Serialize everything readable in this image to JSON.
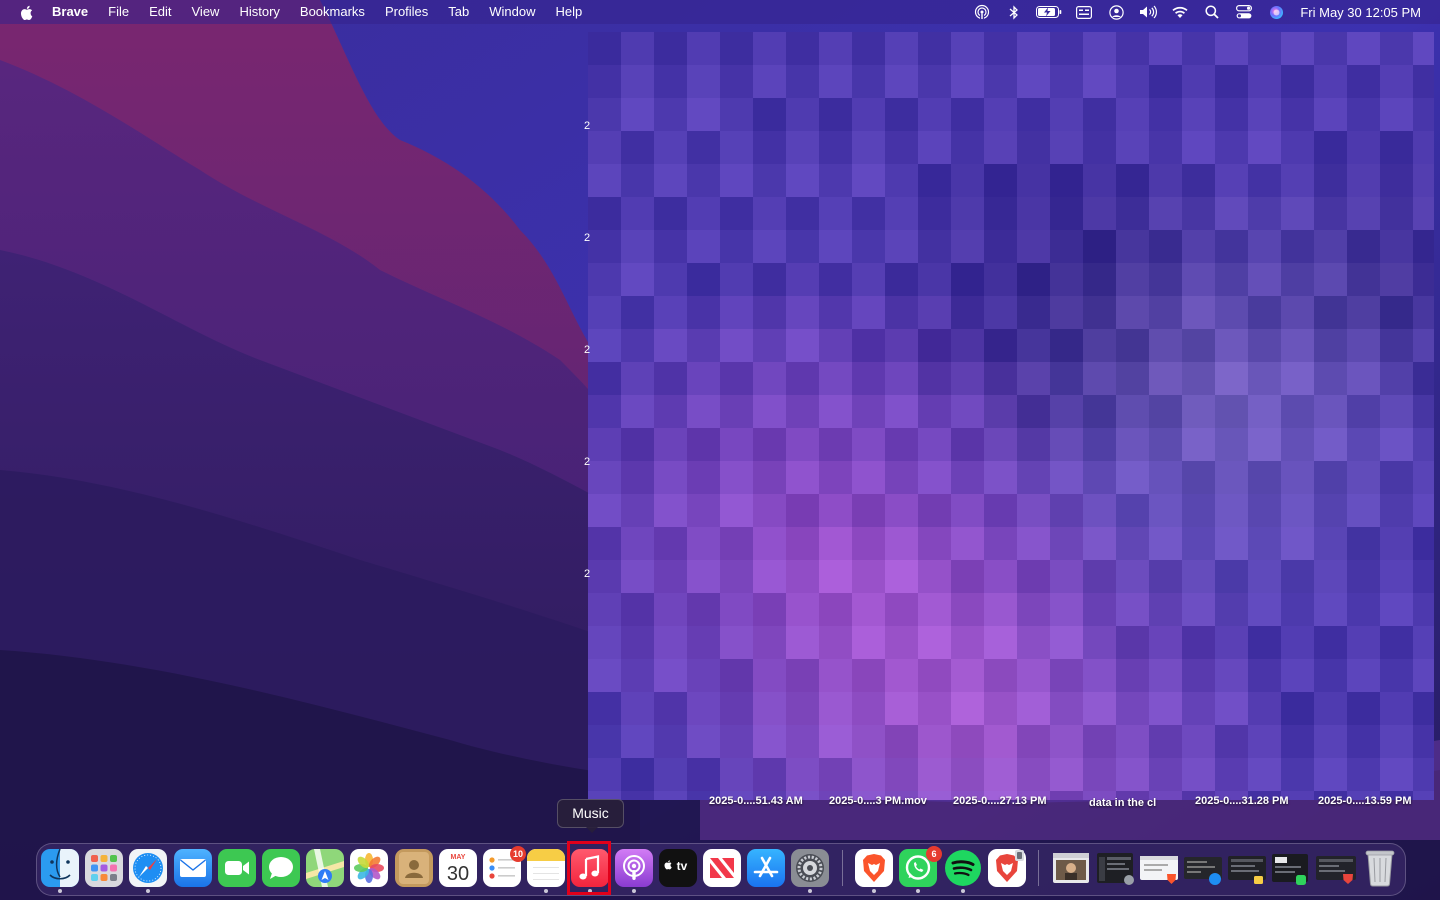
{
  "menubar": {
    "apple_icon": "apple-logo-icon",
    "app_name": "Brave",
    "menus": [
      "File",
      "Edit",
      "View",
      "History",
      "Bookmarks",
      "Profiles",
      "Tab",
      "Window",
      "Help"
    ],
    "status_icons": [
      "airdrop-icon",
      "bluetooth-icon",
      "battery-charging-icon",
      "keyboard-input-icon",
      "user-account-icon",
      "volume-icon",
      "wifi-icon",
      "spotlight-search-icon",
      "control-center-icon",
      "siri-icon"
    ],
    "clock": "Fri May 30  12:05 PM"
  },
  "desktop": {
    "edge_digits": [
      "2",
      "2",
      "2",
      "2",
      "2"
    ],
    "file_labels": [
      "2025-0....51.43 AM",
      "2025-0....3 PM.mov",
      "2025-0....27.13 PM",
      "data in the cl",
      "2025-0....31.28 PM",
      "2025-0....13.59 PM"
    ]
  },
  "tooltip": {
    "text": "Music"
  },
  "dock": {
    "apps": [
      {
        "name": "Finder",
        "icon": "finder-icon",
        "running": true
      },
      {
        "name": "Launchpad",
        "icon": "launchpad-icon",
        "running": false
      },
      {
        "name": "Safari",
        "icon": "safari-icon",
        "running": true
      },
      {
        "name": "Mail",
        "icon": "mail-icon",
        "running": false
      },
      {
        "name": "FaceTime",
        "icon": "facetime-icon",
        "running": false
      },
      {
        "name": "Messages",
        "icon": "messages-icon",
        "running": false
      },
      {
        "name": "Maps",
        "icon": "maps-icon",
        "running": false
      },
      {
        "name": "Photos",
        "icon": "photos-icon",
        "running": false
      },
      {
        "name": "Contacts",
        "icon": "contacts-icon",
        "running": false
      },
      {
        "name": "Calendar",
        "icon": "calendar-icon",
        "running": false,
        "month": "MAY",
        "day": "30"
      },
      {
        "name": "Reminders",
        "icon": "reminders-icon",
        "running": false,
        "badge": "10"
      },
      {
        "name": "Notes",
        "icon": "notes-icon",
        "running": true
      },
      {
        "name": "Music",
        "icon": "music-icon",
        "running": true
      },
      {
        "name": "Podcasts",
        "icon": "podcasts-icon",
        "running": true
      },
      {
        "name": "TV",
        "icon": "apple-tv-icon",
        "running": false,
        "label": "tv"
      },
      {
        "name": "News",
        "icon": "news-icon",
        "running": false
      },
      {
        "name": "App Store",
        "icon": "app-store-icon",
        "running": false
      },
      {
        "name": "System Settings",
        "icon": "system-settings-icon",
        "running": true
      },
      {
        "name": "Brave Browser",
        "icon": "brave-icon",
        "running": true
      },
      {
        "name": "WhatsApp",
        "icon": "whatsapp-icon",
        "running": true,
        "badge": "6"
      },
      {
        "name": "Spotify",
        "icon": "spotify-icon",
        "running": true
      },
      {
        "name": "Brave Browser Beta",
        "icon": "brave-beta-icon",
        "running": false
      }
    ],
    "minimized": [
      "minimized-window-thumbnail-1",
      "minimized-window-thumbnail-2",
      "minimized-window-thumbnail-3",
      "minimized-window-thumbnail-4",
      "minimized-window-thumbnail-5",
      "minimized-window-thumbnail-6",
      "minimized-window-thumbnail-7"
    ],
    "trash": {
      "name": "Trash",
      "icon": "trash-icon"
    },
    "highlighted": "Music",
    "highlight_color": "#e1001a"
  },
  "colors": {
    "wallpaper_base": "#2a1d63",
    "wallpaper_accent": "#7a2a7a"
  }
}
